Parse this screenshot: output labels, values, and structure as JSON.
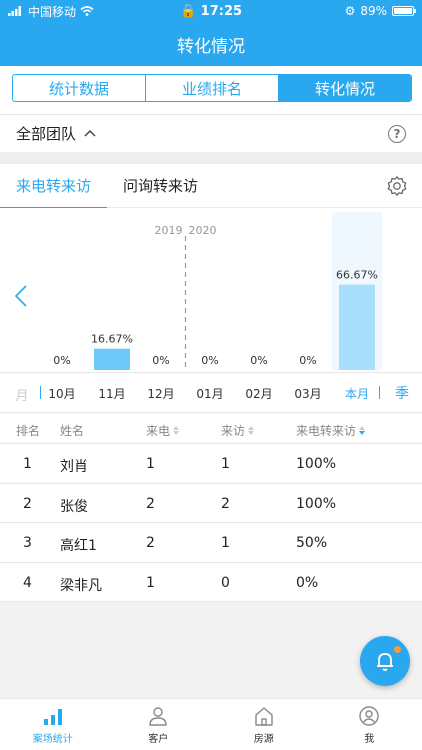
{
  "status": {
    "carrier": "中国移动",
    "time": "17:25",
    "battery": "89%",
    "battery_level": 0.89
  },
  "nav": {
    "title": "转化情况"
  },
  "segments": [
    {
      "label": "统计数据",
      "active": false
    },
    {
      "label": "业绩排名",
      "active": false
    },
    {
      "label": "转化情况",
      "active": true
    }
  ],
  "team": {
    "label": "全部团队"
  },
  "chart_tabs": [
    {
      "label": "来电转来访",
      "active": true
    },
    {
      "label": "问询转来访",
      "active": false
    }
  ],
  "chart_data": {
    "type": "bar",
    "categories": [
      "10月",
      "11月",
      "12月",
      "01月",
      "02月",
      "03月",
      "本月"
    ],
    "values": [
      0,
      16.67,
      0,
      0,
      0,
      0,
      66.67
    ],
    "data_labels": [
      "0%",
      "16.67%",
      "0%",
      "0%",
      "0%",
      "0%",
      "66.67%"
    ],
    "year_divider": {
      "left": "2019",
      "right": "2020",
      "between": [
        "12月",
        "01月"
      ]
    },
    "ylim": [
      0,
      100
    ],
    "highlight_category": "本月",
    "colors": {
      "bar": "#6ec9fb",
      "highlight_bar": "#a6defc",
      "highlight_bg": "#eef8fe"
    }
  },
  "period": {
    "left": "月",
    "right": "季"
  },
  "table": {
    "headers": [
      "排名",
      "姓名",
      "来电",
      "来访",
      "来电转来访"
    ],
    "rows": [
      [
        "1",
        "刘肖",
        "1",
        "1",
        "100%"
      ],
      [
        "2",
        "张俊",
        "2",
        "2",
        "100%"
      ],
      [
        "3",
        "高红1",
        "2",
        "1",
        "50%"
      ],
      [
        "4",
        "梁非凡",
        "1",
        "0",
        "0%"
      ]
    ]
  },
  "tabbar": [
    {
      "label": "案场统计",
      "icon": "bar-chart-icon",
      "active": true
    },
    {
      "label": "客户",
      "icon": "person-icon",
      "active": false
    },
    {
      "label": "房源",
      "icon": "house-icon",
      "active": false
    },
    {
      "label": "我",
      "icon": "profile-icon",
      "active": false
    }
  ],
  "colors": {
    "brand": "#2aa8ef",
    "notification_dot": "#ff9a3a"
  }
}
